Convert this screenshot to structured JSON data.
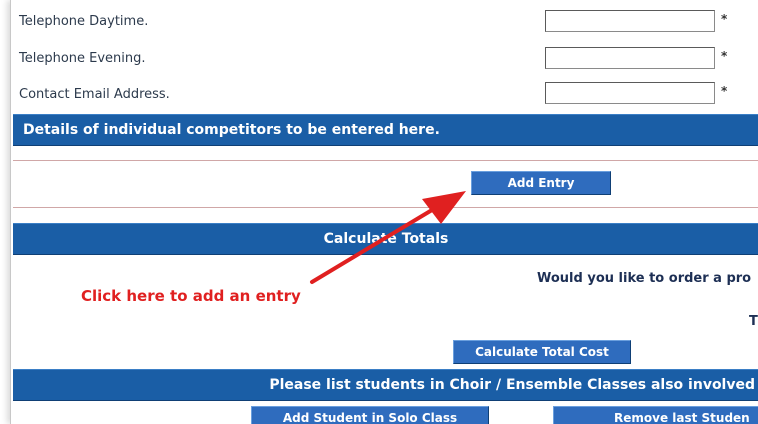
{
  "form": {
    "phone_day_label": "Telephone Daytime.",
    "phone_evening_label": "Telephone Evening.",
    "email_label": "Contact Email Address.",
    "required_mark": "*",
    "phone_day_value": "",
    "phone_evening_value": "",
    "email_value": ""
  },
  "sections": {
    "competitors_header": "Details of individual competitors to be entered here.",
    "calculate_header": "Calculate Totals",
    "choir_header": "Please list students in Choir / Ensemble Classes also involved"
  },
  "buttons": {
    "add_entry": "Add Entry",
    "calculate_total_cost": "Calculate Total Cost",
    "add_student_solo": "Add Student in Solo Class",
    "remove_last_student": "Remove last Studen"
  },
  "texts": {
    "order_prompt": "Would you like to order a pro",
    "truncated_t": "T"
  },
  "annotation": {
    "text": "Click here to add an entry",
    "color": "#e02020"
  },
  "colors": {
    "header_bar": "#1a5ea6",
    "button": "#2f6cbe",
    "label_text": "#2c3a4c"
  }
}
